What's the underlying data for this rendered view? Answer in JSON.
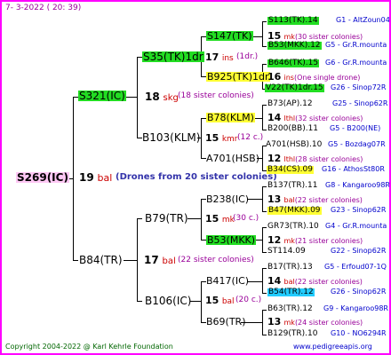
{
  "header": {
    "date": "7-  3-2022  ( 20: 39)"
  },
  "root": {
    "id": "S269(IC)",
    "num": "19",
    "kind": "bal",
    "note": "(Drones from 20 sister colonies)"
  },
  "level1": [
    {
      "id": "S321(IC)",
      "num": "18",
      "kind": "skg",
      "note": "(18 sister colonies)"
    },
    {
      "id": "B84(TR)",
      "num": "17",
      "kind": "bal",
      "note": "(22 sister colonies)"
    }
  ],
  "level2": [
    {
      "id": "S35(TK)1dr",
      "num": "17",
      "kind": "ins",
      "note": "(1dr.)"
    },
    {
      "id": "B103(KLM)",
      "num": "15",
      "kind": "kmr",
      "note": "(12 c.)"
    },
    {
      "id": "B79(TR)",
      "num": "15",
      "kind": "mk",
      "note": "(30 c.)"
    },
    {
      "id": "B106(IC)",
      "num": "15",
      "kind": "bal",
      "note": "(20 c.)"
    }
  ],
  "level3": [
    {
      "id": "S147(TK)",
      "num": "15",
      "kind": "mk",
      "note": "(30 sister colonies)"
    },
    {
      "id": "B925(TK)1dr",
      "num": "16",
      "kind": "ins",
      "note": "(One single drone)"
    },
    {
      "id": "B78(KLM)",
      "num": "14",
      "kind": "lthl",
      "note": "(32 sister colonies)"
    },
    {
      "id": "A701(HSB)",
      "num": "12",
      "kind": "lthl",
      "note": "(28 sister colonies)"
    },
    {
      "id": "B238(IC)",
      "num": "13",
      "kind": "bal",
      "note": "(22 sister colonies)"
    },
    {
      "id": "B53(MKK)",
      "num": "12",
      "kind": "mk",
      "note": "(21 sister colonies)"
    },
    {
      "id": "B417(IC)",
      "num": "14",
      "kind": "bal",
      "note": "(22 sister colonies)"
    },
    {
      "id": "B69(TR)",
      "num": "13",
      "kind": "mk",
      "note": "(24 sister colonies)"
    }
  ],
  "level4": [
    {
      "id": "S113(TK).14",
      "src": "G1 - AltZoun04"
    },
    {
      "id": "B53(MKK).12",
      "src": "G5 - Gr.R.mounta"
    },
    {
      "id": "B646(TK).15",
      "src": "G6 - Gr.R.mounta"
    },
    {
      "id": "V22(TK)1dr.15",
      "src": "G26 - Sinop72R"
    },
    {
      "id": "B73(AP).12",
      "src": "G25 - Sinop62R"
    },
    {
      "id": "B200(BB).11",
      "src": "G5 - B200(NE)"
    },
    {
      "id": "A701(HSB).10",
      "src": "G5 - Bozdag07R"
    },
    {
      "id": "B34(CS).09",
      "src": "G16 - AthosSt80R"
    },
    {
      "id": "B137(TR).11",
      "src": "G8 - Kangaroo98R"
    },
    {
      "id": "B47(MKK).09",
      "src": "G23 - Sinop62R"
    },
    {
      "id": "GR73(TR).10",
      "src": "G4 - Gr.R.mounta"
    },
    {
      "id": "ST114.09",
      "src": "G22 - Sinop62R"
    },
    {
      "id": "B17(TR).13",
      "src": "G5 - Erfoud07-1Q"
    },
    {
      "id": "B54(TR).12",
      "src": "G26 - Sinop62R"
    },
    {
      "id": "B63(TR).12",
      "src": "G9 - Kangaroo98R"
    },
    {
      "id": "B129(TR).10",
      "src": "G10 - NO6294R"
    }
  ],
  "footer": {
    "copyright": "Copyright 2004-2022 @ Karl Kehrle Foundation",
    "url": "www.pedigreeapis.org"
  },
  "colors": {
    "frame": "#ff00ff",
    "green_box": "#22dd22",
    "yellow_box": "#ffff33",
    "cyan_box": "#22ccff",
    "root_box": "#ffc8f5",
    "root_note": "#3333aa"
  }
}
